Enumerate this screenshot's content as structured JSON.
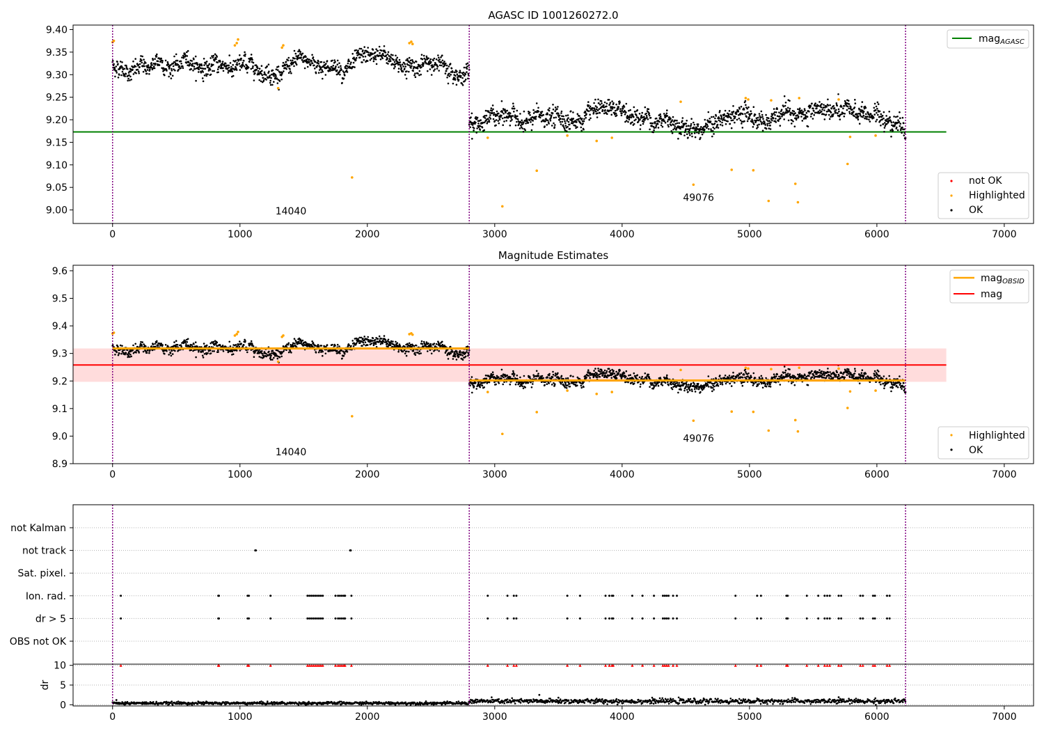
{
  "chart_data": [
    {
      "type": "scatter",
      "title": "AGASC ID 1001260272.0",
      "xlim": [
        -310,
        7230
      ],
      "ylim": [
        8.97,
        9.41
      ],
      "xticks": [
        0,
        1000,
        2000,
        3000,
        4000,
        5000,
        6000,
        7000
      ],
      "yticks": [
        9.0,
        9.05,
        9.1,
        9.15,
        9.2,
        9.25,
        9.3,
        9.35,
        9.4
      ],
      "ytick_decimals": 2,
      "vlines": [
        0,
        2800,
        6225
      ],
      "mag_agasc": 9.173,
      "hline_xrange": [
        -310,
        6545
      ],
      "obsid_segments": [
        {
          "label": "14040",
          "x_start": 0,
          "x_end": 2800,
          "mean": 9.32,
          "wander": 0.012,
          "noise": 0.009,
          "label_x": 1400,
          "label_y": 8.99
        },
        {
          "label": "49076",
          "x_start": 2800,
          "x_end": 6225,
          "mean": 9.2,
          "wander": 0.012,
          "noise": 0.01,
          "label_x": 4600,
          "label_y": 9.02
        }
      ],
      "ok_point_step": 2.5,
      "highlighted": [
        [
          0,
          9.372
        ],
        [
          10,
          9.375
        ],
        [
          960,
          9.365
        ],
        [
          975,
          9.37
        ],
        [
          985,
          9.378
        ],
        [
          1300,
          9.27
        ],
        [
          1330,
          9.36
        ],
        [
          1340,
          9.365
        ],
        [
          1880,
          9.072
        ],
        [
          2330,
          9.37
        ],
        [
          2345,
          9.373
        ],
        [
          2355,
          9.368
        ],
        [
          2945,
          9.16
        ],
        [
          3060,
          9.008
        ],
        [
          3330,
          9.087
        ],
        [
          3570,
          9.165
        ],
        [
          3800,
          9.153
        ],
        [
          3920,
          9.16
        ],
        [
          4460,
          9.24
        ],
        [
          4560,
          9.056
        ],
        [
          4860,
          9.089
        ],
        [
          4970,
          9.248
        ],
        [
          4990,
          9.245
        ],
        [
          5030,
          9.088
        ],
        [
          5150,
          9.02
        ],
        [
          5170,
          9.243
        ],
        [
          5360,
          9.058
        ],
        [
          5380,
          9.017
        ],
        [
          5390,
          9.248
        ],
        [
          5700,
          9.245
        ],
        [
          5770,
          9.102
        ],
        [
          5790,
          9.162
        ],
        [
          5990,
          9.165
        ]
      ],
      "legend": {
        "entries": [
          "mag_AGASC"
        ],
        "position": "upper right"
      },
      "legend2": {
        "entries": [
          "not OK",
          "Highlighted",
          "OK"
        ],
        "position": "lower right"
      }
    },
    {
      "type": "scatter",
      "title": "Magnitude Estimates",
      "xlim": [
        -310,
        7230
      ],
      "ylim": [
        8.9,
        9.62
      ],
      "xticks": [
        0,
        1000,
        2000,
        3000,
        4000,
        5000,
        6000,
        7000
      ],
      "yticks": [
        8.9,
        9.0,
        9.1,
        9.2,
        9.3,
        9.4,
        9.5,
        9.6
      ],
      "ytick_decimals": 1,
      "vlines": [
        0,
        2800,
        6225
      ],
      "mag": 9.258,
      "mag_band": [
        9.197,
        9.318
      ],
      "mag_obsid": [
        {
          "x_start": 0,
          "x_end": 2800,
          "value": 9.318
        },
        {
          "x_start": 2800,
          "x_end": 6225,
          "value": 9.202
        }
      ],
      "hline_xrange": [
        -310,
        6545
      ],
      "obsid_labels": [
        {
          "label": "14040",
          "x": 1400,
          "y": 8.93
        },
        {
          "label": "49076",
          "x": 4600,
          "y": 8.98
        }
      ],
      "legend": {
        "entries": [
          "mag_OBSID",
          "mag"
        ],
        "position": "upper right"
      },
      "legend2": {
        "entries": [
          "Highlighted",
          "OK"
        ],
        "position": "lower right"
      }
    },
    {
      "type": "scatter",
      "title": "",
      "xlim": [
        -310,
        7230
      ],
      "xticks": [
        0,
        1000,
        2000,
        3000,
        4000,
        5000,
        6000,
        7000
      ],
      "flag_labels": [
        "not Kalman",
        "not track",
        "Sat. pixel.",
        "Ion. rad.",
        "dr > 5",
        "OBS not OK"
      ],
      "flags": {
        "not track": [
          1120,
          1125,
          1865,
          1870
        ],
        "Ion. rad.": [
          65,
          830,
          835,
          1060,
          1070,
          1240,
          1530,
          1545,
          1560,
          1575,
          1590,
          1605,
          1620,
          1635,
          1650,
          1750,
          1770,
          1785,
          1800,
          1815,
          1825,
          1875,
          2945,
          3100,
          3150,
          3170,
          3570,
          3670,
          3870,
          3900,
          3920,
          3930,
          4080,
          4160,
          4250,
          4320,
          4335,
          4350,
          4365,
          4400,
          4430,
          4890,
          5060,
          5090,
          5290,
          5300,
          5450,
          5540,
          5590,
          5610,
          5630,
          5700,
          5720,
          5870,
          5890,
          5970,
          5985,
          6080,
          6100
        ],
        "dr > 5": [
          65,
          830,
          835,
          1060,
          1070,
          1240,
          1530,
          1545,
          1560,
          1575,
          1590,
          1605,
          1620,
          1635,
          1650,
          1750,
          1770,
          1785,
          1800,
          1815,
          1825,
          1875,
          2945,
          3100,
          3150,
          3170,
          3570,
          3670,
          3870,
          3900,
          3920,
          3930,
          4080,
          4160,
          4250,
          4320,
          4335,
          4350,
          4365,
          4400,
          4430,
          4890,
          5060,
          5090,
          5290,
          5300,
          5450,
          5540,
          5590,
          5610,
          5630,
          5700,
          5720,
          5870,
          5890,
          5970,
          5985,
          6080,
          6100
        ]
      },
      "dr": {
        "ylabel": "dr",
        "yticks": [
          0,
          5,
          10
        ],
        "ylim": [
          -0.3,
          10.3
        ],
        "clip_value": 10,
        "segments": [
          {
            "x_start": 0,
            "x_end": 2800,
            "mean": 0.4,
            "noise": 0.18
          },
          {
            "x_start": 2800,
            "x_end": 6225,
            "mean": 0.9,
            "noise": 0.3
          }
        ],
        "point_step": 4,
        "outliers": [
          [
            30,
            1.2
          ],
          [
            3350,
            2.5
          ],
          [
            3500,
            1.8
          ],
          [
            5700,
            1.9
          ]
        ]
      },
      "vlines": [
        0,
        2800,
        6225
      ]
    }
  ],
  "colors": {
    "ok": "#000000",
    "highlighted": "#ffa500",
    "not_ok": "#ff0000",
    "mag_agasc": "#008000",
    "mag_obsid": "#ffa500",
    "mag": "#ff0000",
    "mag_band": "#ffdcdc",
    "vline": "#800080",
    "grid": "#b0b0b0"
  }
}
